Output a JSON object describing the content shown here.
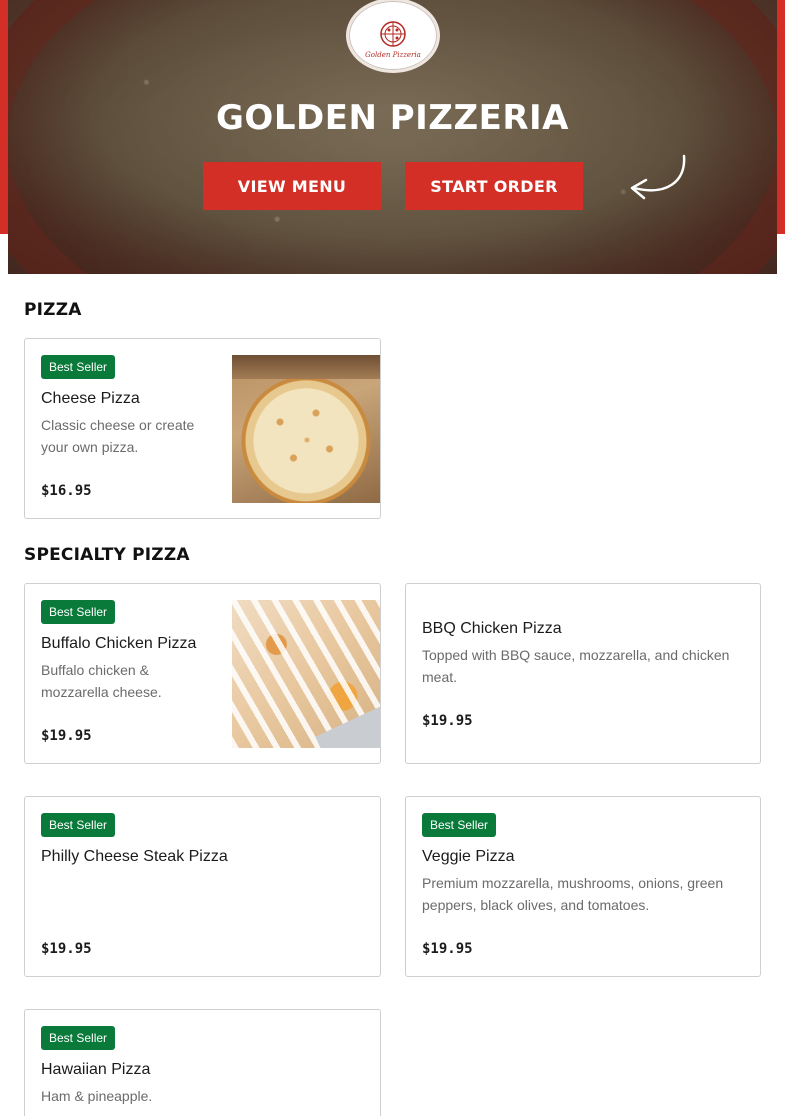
{
  "hero": {
    "logo_text": "Golden Pizzeria",
    "brand": "GOLDEN PIZZERIA",
    "view_menu": "VIEW MENU",
    "start_order": "START ORDER"
  },
  "colors": {
    "accent": "#d32f27",
    "badge": "#0a7a3a"
  },
  "sections": [
    {
      "title": "PIZZA",
      "items": [
        {
          "badge": "Best Seller",
          "name": "Cheese Pizza",
          "desc_line1": "Classic cheese or create",
          "desc_line2": "your own pizza.",
          "price": "$16.95",
          "image": "cheese-pizza-photo"
        }
      ]
    },
    {
      "title": "SPECIALTY PIZZA",
      "items": [
        {
          "badge": "Best Seller",
          "name": "Buffalo Chicken Pizza",
          "desc_line1": "Buffalo chicken &",
          "desc_line2": "mozzarella cheese.",
          "price": "$19.95",
          "image": "buffalo-chicken-pizza-photo"
        },
        {
          "name": "BBQ Chicken Pizza",
          "desc_line1": "Topped with BBQ sauce, mozzarella, and chicken",
          "desc_line2": "meat.",
          "price": "$19.95"
        },
        {
          "badge": "Best Seller",
          "name": "Philly Cheese Steak Pizza",
          "price": "$19.95"
        },
        {
          "badge": "Best Seller",
          "name": "Veggie Pizza",
          "desc_line1": "Premium mozzarella, mushrooms, onions, green",
          "desc_line2": "peppers, black olives, and tomatoes.",
          "price": "$19.95"
        },
        {
          "badge": "Best Seller",
          "name": "Hawaiian Pizza",
          "desc_line1": "Ham & pineapple."
        }
      ]
    }
  ]
}
